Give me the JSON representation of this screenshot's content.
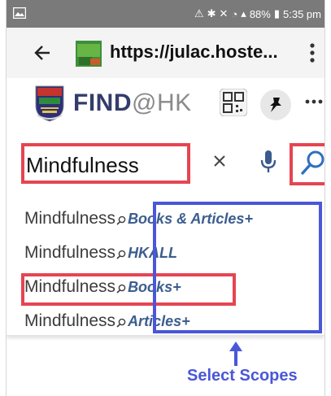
{
  "status_bar": {
    "battery": "88%",
    "time": "5:35 pm",
    "icons": [
      "photo-icon",
      "warning-icon",
      "bluetooth-icon",
      "mute-icon",
      "wifi-icon",
      "signal-icon",
      "battery-icon"
    ]
  },
  "browser": {
    "url": "https://julac.hoste...",
    "icons": [
      "back-arrow-icon",
      "site-icon",
      "kebab-menu-icon"
    ]
  },
  "header": {
    "find_bold": "FIND",
    "find_suffix": "@HK",
    "icons": [
      "hku-logo",
      "qr-code-icon",
      "pin-icon",
      "more-dots-icon"
    ]
  },
  "search": {
    "value": "Mindfulness",
    "icons": [
      "clear-icon",
      "microphone-icon",
      "search-icon"
    ]
  },
  "suggestions": [
    {
      "term": "Mindfulness",
      "scope": "Books & Articles+"
    },
    {
      "term": "Mindfulness",
      "scope": "HKALL"
    },
    {
      "term": "Mindfulness",
      "scope": "Books+"
    },
    {
      "term": "Mindfulness",
      "scope": "Articles+"
    }
  ],
  "annotation": {
    "label": "Select Scopes"
  },
  "colors": {
    "highlight_red": "#e54552",
    "highlight_blue": "#4a57d8",
    "scope_text": "#3c5d8f",
    "brand_navy": "#333d6b",
    "status_bar_bg": "#7a7a7a"
  }
}
